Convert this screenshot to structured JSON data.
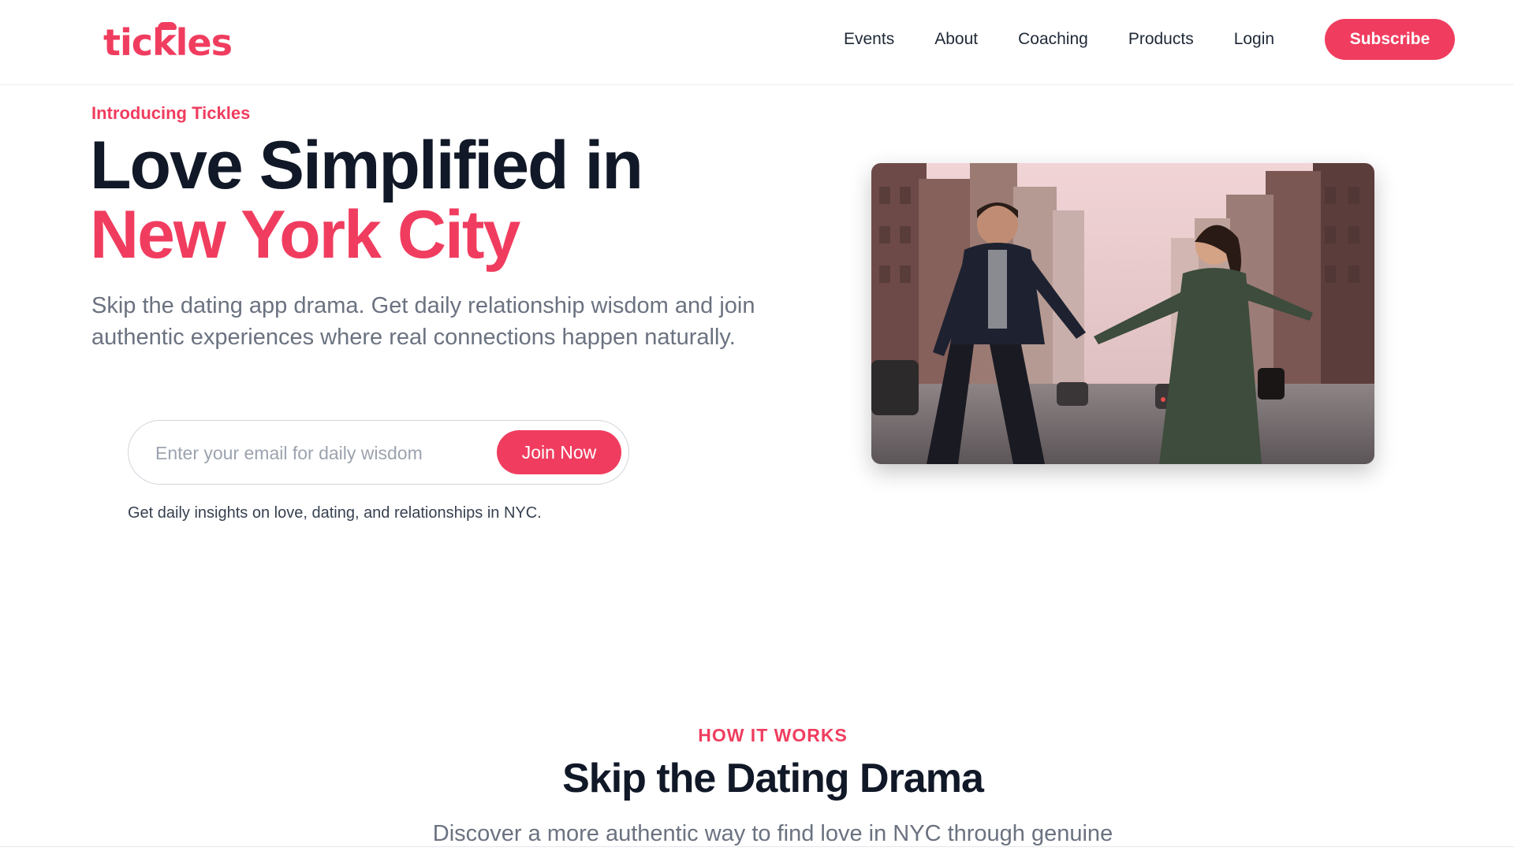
{
  "brand": {
    "logo_text": "tickles",
    "accent_color": "#f03d5f"
  },
  "nav": {
    "items": [
      {
        "label": "Events"
      },
      {
        "label": "About"
      },
      {
        "label": "Coaching"
      },
      {
        "label": "Products"
      },
      {
        "label": "Login"
      }
    ],
    "subscribe_label": "Subscribe"
  },
  "hero": {
    "eyebrow": "Introducing Tickles",
    "title_line1": "Love Simplified in",
    "title_line2": "New York City",
    "subtitle": "Skip the dating app drama. Get daily relationship wisdom and join authentic experiences where real connections happen naturally.",
    "email_placeholder": "Enter your email for daily wisdom",
    "email_value": "",
    "join_label": "Join Now",
    "note": "Get daily insights on love, dating, and relationships in NYC.",
    "image_icon": "couple-photo-icon"
  },
  "how_it_works": {
    "eyebrow": "HOW IT WORKS",
    "title": "Skip the Dating Drama",
    "subtitle": "Discover a more authentic way to find love in NYC through genuine"
  }
}
